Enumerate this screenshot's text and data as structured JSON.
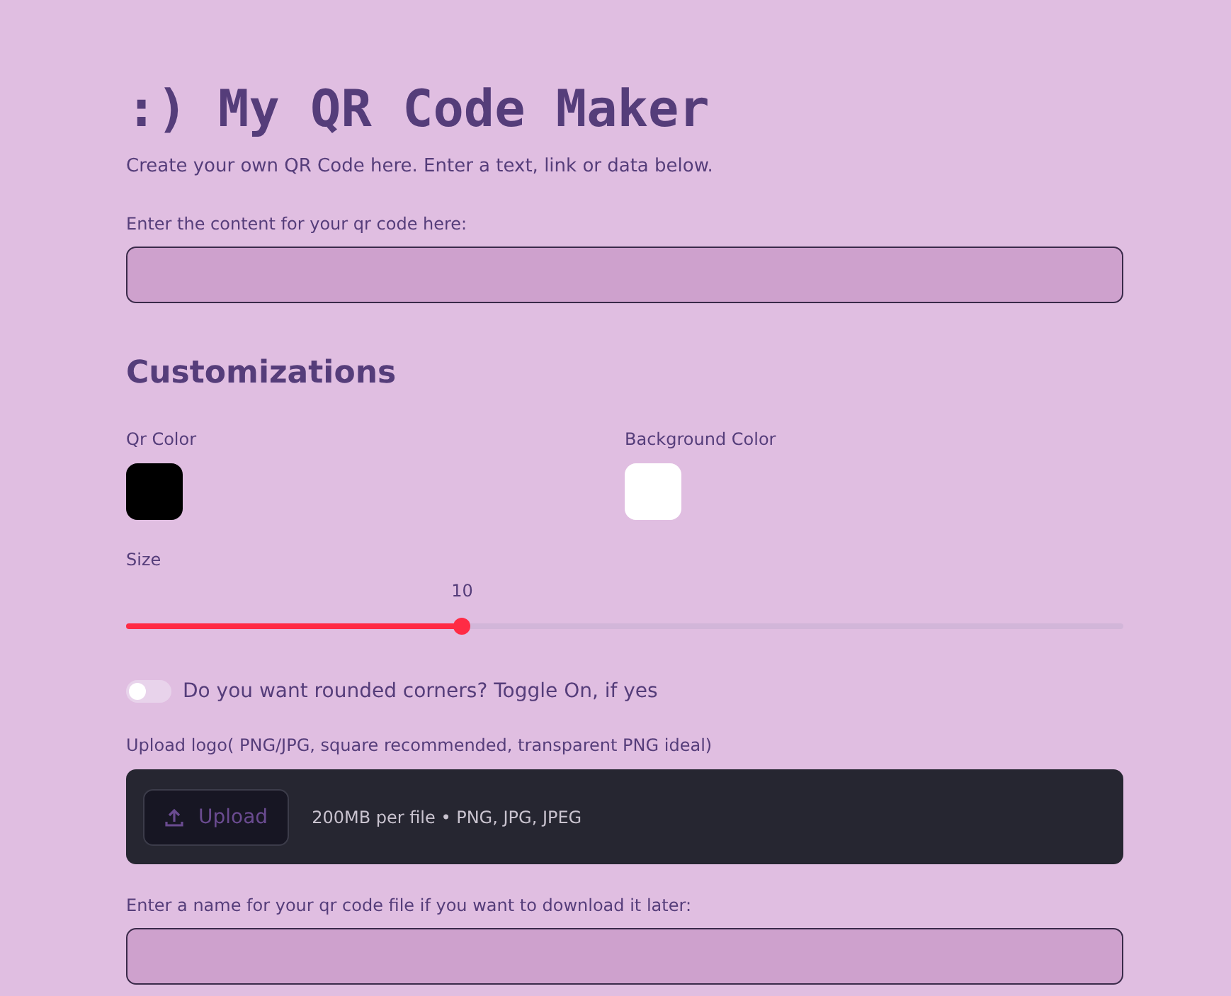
{
  "title": ":) My QR Code Maker",
  "subtitle": "Create your own QR Code here. Enter a text, link or data below.",
  "content_field": {
    "label": "Enter the content for your qr code here:"
  },
  "customizations": {
    "heading": "Customizations",
    "colors": [
      {
        "label": "Qr Color",
        "color": "#000000"
      },
      {
        "label": "Background Color",
        "color": "#ffffff"
      }
    ],
    "size": {
      "label": "Size",
      "reading": "10",
      "level": 0.337
    },
    "rounded_toggle": {
      "label": "Do you want rounded corners? Toggle On, if yes",
      "on": false
    }
  },
  "upload": {
    "label": "Upload logo( PNG/JPG, square recommended, transparent PNG ideal)",
    "button": "Upload",
    "hint": "200MB per file • PNG, JPG, JPEG"
  },
  "file_name_field": {
    "label": "Enter a name for your qr code file if you want to download it later:"
  }
}
